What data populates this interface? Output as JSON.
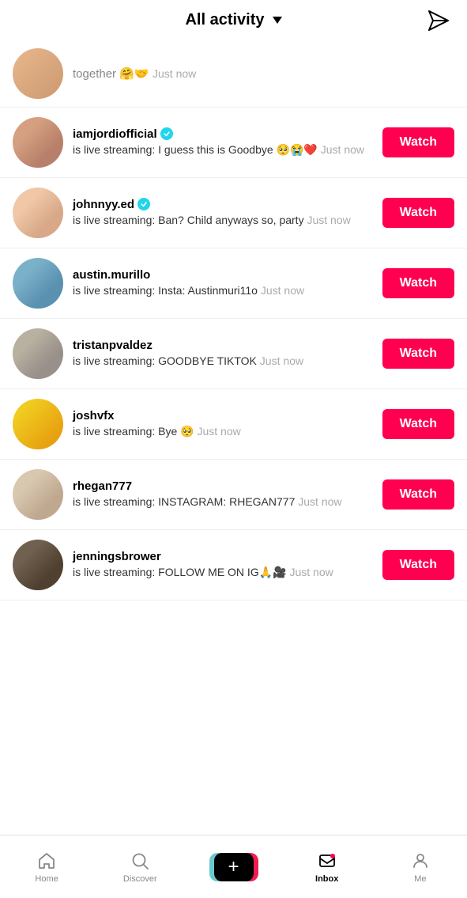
{
  "header": {
    "title": "All activity",
    "send_icon": "send-icon"
  },
  "partial_item": {
    "text": "together 🤗🤝",
    "timestamp": "Just now"
  },
  "items": [
    {
      "id": 1,
      "username": "iamjordiofficial",
      "verified": true,
      "description": "is live streaming: I guess this is Goodbye 🥺😭❤️",
      "timestamp": "Just now",
      "avatar_class": "avatar-1",
      "watch_label": "Watch"
    },
    {
      "id": 2,
      "username": "johnnyy.ed",
      "verified": true,
      "description": "is live streaming: Ban? Child anyways so, party",
      "timestamp": "Just now",
      "avatar_class": "avatar-2",
      "watch_label": "Watch"
    },
    {
      "id": 3,
      "username": "austin.murillo",
      "verified": false,
      "description": "is live streaming: Insta: Austinmuri11o",
      "timestamp": "Just now",
      "avatar_class": "avatar-3",
      "watch_label": "Watch"
    },
    {
      "id": 4,
      "username": "tristanpvaldez",
      "verified": false,
      "description": "is live streaming: GOODBYE TIKTOK",
      "timestamp": "Just now",
      "avatar_class": "avatar-4",
      "watch_label": "Watch"
    },
    {
      "id": 5,
      "username": "joshvfx",
      "verified": false,
      "description": "is live streaming: Bye 🥺",
      "timestamp": "Just now",
      "avatar_class": "avatar-5",
      "watch_label": "Watch"
    },
    {
      "id": 6,
      "username": "rhegan777",
      "verified": false,
      "description": "is live streaming: INSTAGRAM: RHEGAN777",
      "timestamp": "Just now",
      "avatar_class": "avatar-6",
      "watch_label": "Watch"
    },
    {
      "id": 7,
      "username": "jenningsbrower",
      "verified": false,
      "description": "is live streaming: FOLLOW ME ON IG🙏🎥",
      "timestamp": "Just now",
      "avatar_class": "avatar-7",
      "watch_label": "Watch"
    }
  ],
  "nav": {
    "items": [
      {
        "label": "Home",
        "icon": "home-icon",
        "active": false
      },
      {
        "label": "Discover",
        "icon": "discover-icon",
        "active": false
      },
      {
        "label": "",
        "icon": "plus-icon",
        "active": false
      },
      {
        "label": "Inbox",
        "icon": "inbox-icon",
        "active": true
      },
      {
        "label": "Me",
        "icon": "me-icon",
        "active": false
      }
    ]
  }
}
